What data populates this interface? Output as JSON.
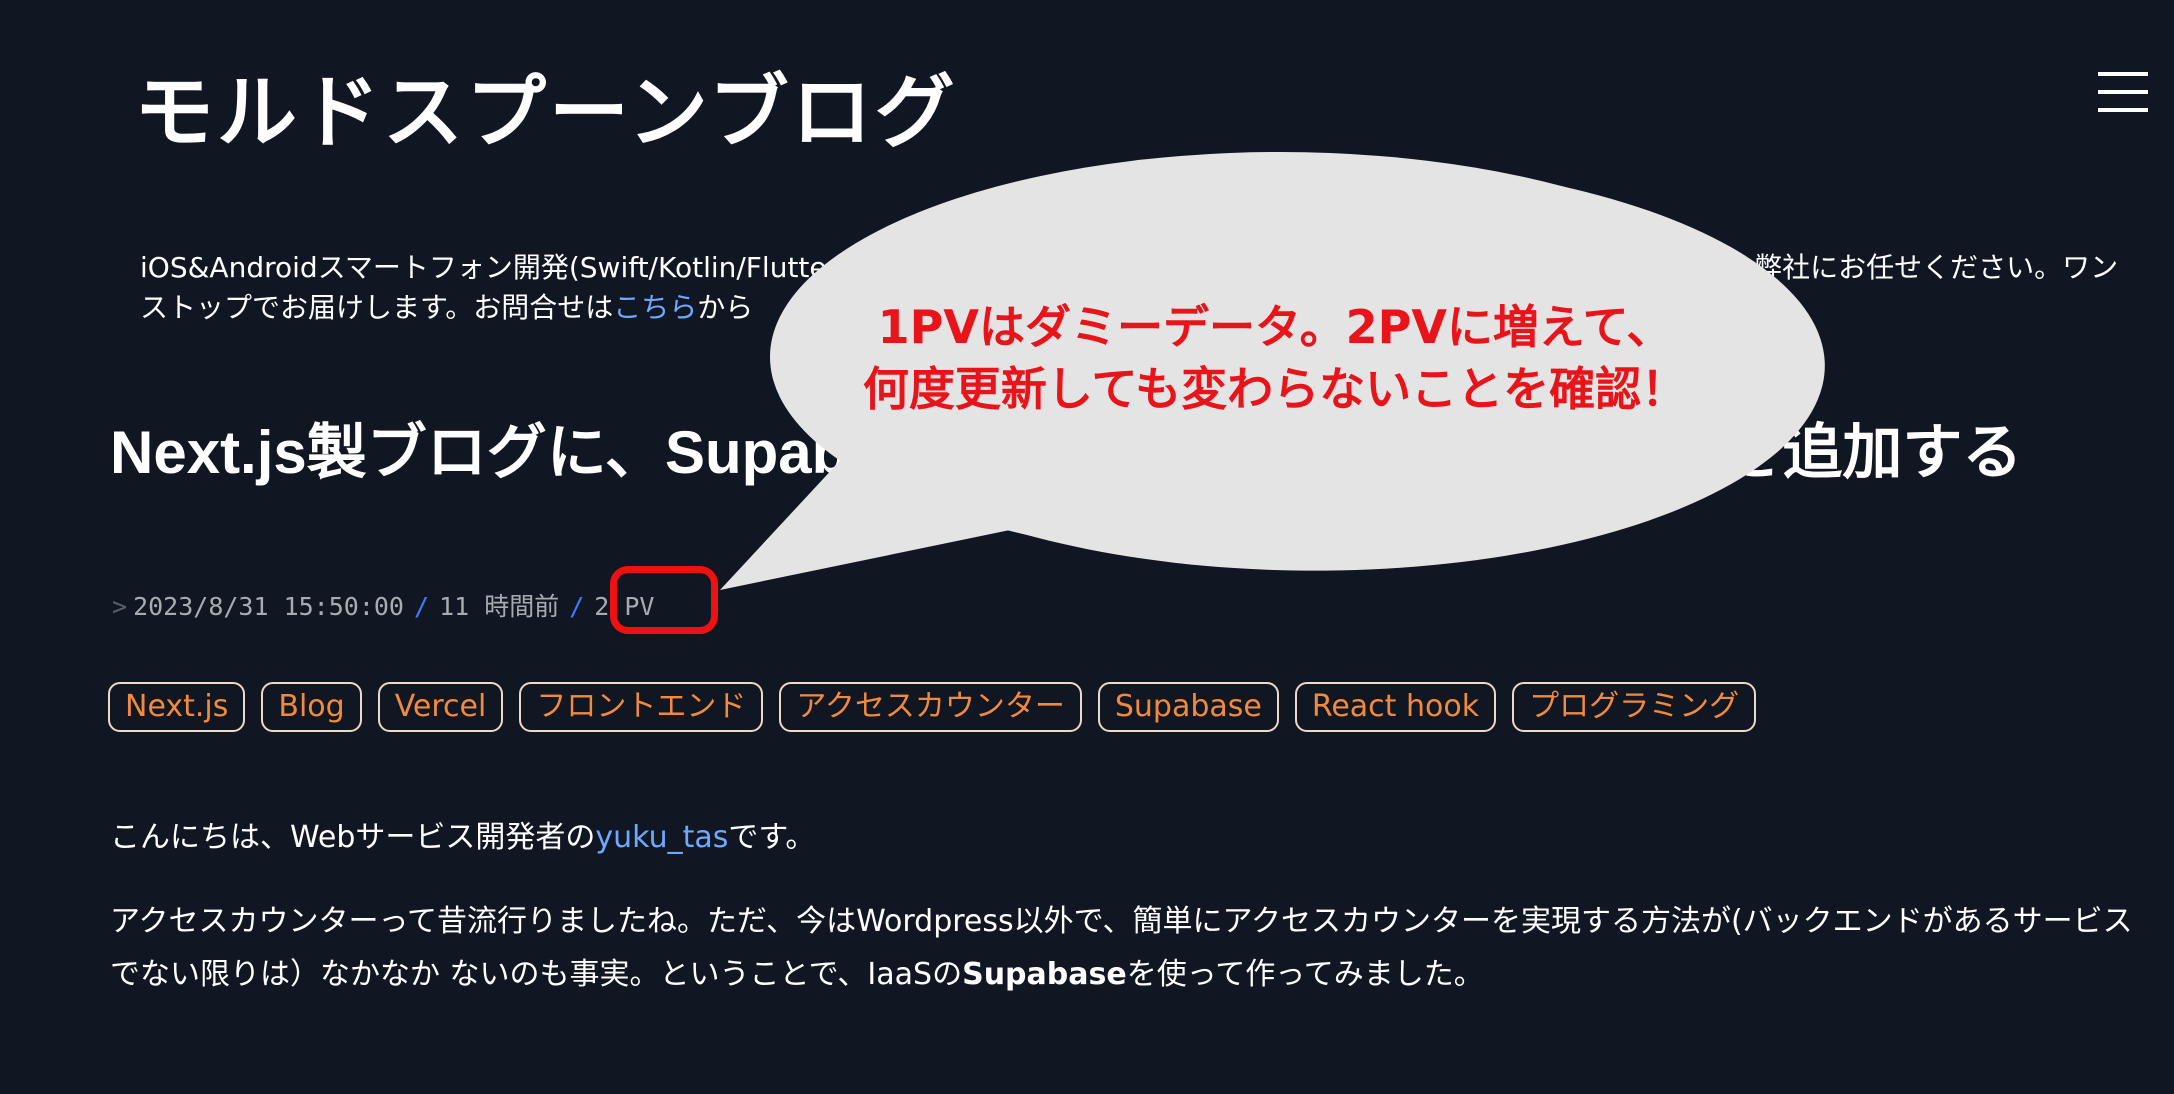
{
  "header": {
    "logo_text": "モルドスプーンブログ",
    "menu_icon": "hamburger-menu-icon"
  },
  "intro": {
    "text_before": "iOS&Androidスマートフォン開発(Swift/Kotlin/Flutter)",
    "text_hidden_gap": " ",
    "text_right": "弊社にお任せください。ワンストップでお届けします。お問合せは",
    "link_text": "こちら",
    "text_after": "から"
  },
  "article": {
    "title": "Next.js製ブログに、Supabaseを使ってアクセスカウンターを追加する",
    "meta": {
      "arrow": ">",
      "datetime": "2023/8/31 15:50:00",
      "relative_time": "11 時間前",
      "separator": "/",
      "pv": "2 PV"
    },
    "tags": [
      "Next.js",
      "Blog",
      "Vercel",
      "フロントエンド",
      "アクセスカウンター",
      "Supabase",
      "React hook",
      "プログラミング"
    ],
    "greeting_before": "こんにちは、Webサービス開発者の",
    "greeting_link": "yuku_tas",
    "greeting_after": "です。",
    "body_before": "アクセスカウンターって昔流行りましたね。ただ、今はWordpress以外で、簡単にアクセスカウンターを実現する方法が(バックエンドがあるサービスでない限りは）なかなか ないのも事実。ということで、IaaSの",
    "body_bold": "Supabase",
    "body_after": "を使って作ってみました。"
  },
  "annotation": {
    "line1": "1PVはダミーデータ。2PVに増えて、",
    "line2": "何度更新しても変わらないことを確認！",
    "text_color": "#e8141a",
    "bubble_color": "#e4e4e4",
    "highlight_color": "#ee1111"
  },
  "colors": {
    "background": "#111722",
    "link": "#6ea8ff",
    "tag_text": "#f28a3c",
    "tag_border": "#f0d9c4"
  }
}
